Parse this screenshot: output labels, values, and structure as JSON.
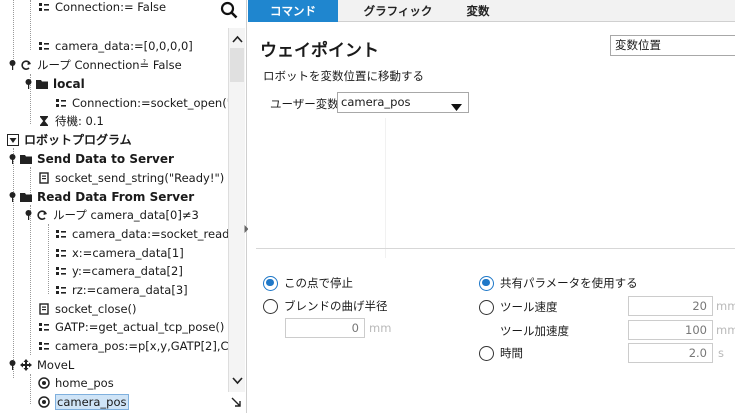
{
  "tree": {
    "rows": [
      "Connection:= False",
      "camera_data:=[0,0,0,0]",
      "ループ Connection≟ False",
      "local",
      "Connection:=socket_open('",
      "待機: 0.1",
      "ロボットプログラム",
      "Send Data to Server",
      "socket_send_string(\"Ready!\")",
      "Read Data From Server",
      "ループ camera_data[0]≠3",
      "camera_data:=socket_read",
      "x:=camera_data[1]",
      "y:=camera_data[2]",
      "rz:=camera_data[3]",
      "socket_close()",
      "GATP:=get_actual_tcp_pose()",
      "camera_pos:=p[x,y,GATP[2],C",
      "MoveL",
      "home_pos",
      "camera_pos"
    ]
  },
  "tabs": [
    "コマンド",
    "グラフィック",
    "変数"
  ],
  "waypoint": {
    "title": "ウェイポイント",
    "mode_value": "変数位置",
    "description": "ロボットを変数位置に移動する",
    "user_var_label": "ユーザー変数",
    "user_var_value": "camera_pos"
  },
  "options": {
    "stop_label": "この点で停止",
    "blend_label": "ブレンドの曲げ半径",
    "blend_value": "0",
    "blend_unit": "mm",
    "shared_label": "共有パラメータを使用する",
    "tool_speed_label": "ツール速度",
    "tool_speed_value": "20",
    "tool_speed_unit": "mm",
    "tool_accel_label": "ツール加速度",
    "tool_accel_value": "100",
    "tool_accel_unit": "mm",
    "time_label": "時間",
    "time_value": "2.0",
    "time_unit": "s"
  },
  "colors": {
    "accent": "#1f86cf",
    "radio_selected": "#1f78c8",
    "selection": "#cfe4f7"
  }
}
